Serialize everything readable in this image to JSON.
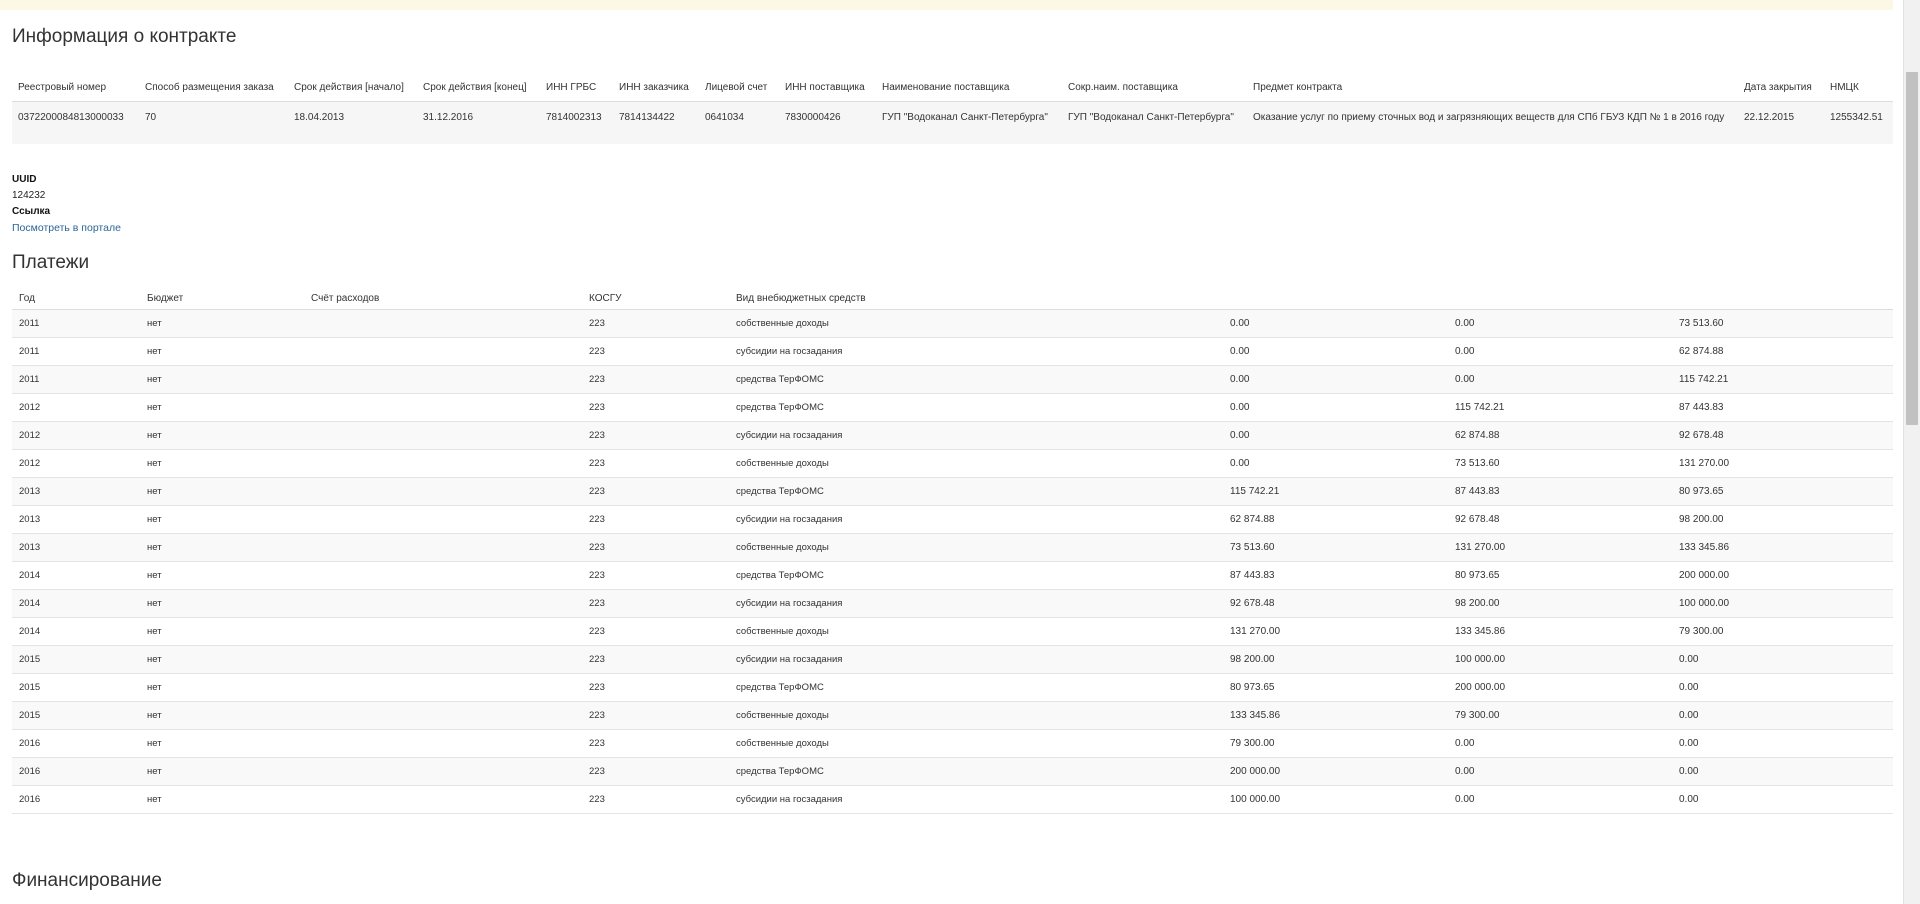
{
  "contract": {
    "title": "Информация о контракте",
    "headers": [
      "Реестровый номер",
      "Способ размещения заказа",
      "Срок действия [начало]",
      "Срок действия [конец]",
      "ИНН ГРБС",
      "ИНН заказчика",
      "Лицевой счет",
      "ИНН поставщика",
      "Наименование поставщика",
      "Сокр.наим. поставщика",
      "Предмет контракта",
      "Дата закрытия",
      "НМЦК"
    ],
    "row": {
      "reg_number": "0372200084813000033",
      "method": "70",
      "start": "18.04.2013",
      "end": "31.12.2016",
      "inn_grbs": "7814002313",
      "inn_customer": "7814134422",
      "account": "0641034",
      "inn_supplier": "7830000426",
      "supplier_name": "ГУП \"Водоканал Санкт-Петербурга\"",
      "supplier_short": "ГУП \"Водоканал Санкт-Петербурга\"",
      "subject": "Оказание услуг по приему сточных вод и загрязняющих веществ для СПб ГБУЗ КДП № 1 в 2016 году",
      "close_date": "22.12.2015",
      "nmck": "1255342.51"
    }
  },
  "info": {
    "uuid_label": "UUID",
    "uuid_value": "124232",
    "link_label": "Ссылка",
    "link_text": "Посмотреть в портале"
  },
  "payments": {
    "title": "Платежи",
    "headers": [
      "Год",
      "Бюджет",
      "Счёт расходов",
      "КОСГУ",
      "Вид внебюджетных средств",
      "",
      "",
      ""
    ],
    "rows": [
      {
        "year": "2011",
        "budget": "нет",
        "account": "",
        "kosgu": "223",
        "kind": "собственные доходы",
        "v1": "0.00",
        "v2": "0.00",
        "v3": "73 513.60"
      },
      {
        "year": "2011",
        "budget": "нет",
        "account": "",
        "kosgu": "223",
        "kind": "субсидии на госзадания",
        "v1": "0.00",
        "v2": "0.00",
        "v3": "62 874.88"
      },
      {
        "year": "2011",
        "budget": "нет",
        "account": "",
        "kosgu": "223",
        "kind": "средства ТерФОМС",
        "v1": "0.00",
        "v2": "0.00",
        "v3": "115 742.21"
      },
      {
        "year": "2012",
        "budget": "нет",
        "account": "",
        "kosgu": "223",
        "kind": "средства ТерФОМС",
        "v1": "0.00",
        "v2": "115 742.21",
        "v3": "87 443.83"
      },
      {
        "year": "2012",
        "budget": "нет",
        "account": "",
        "kosgu": "223",
        "kind": "субсидии на госзадания",
        "v1": "0.00",
        "v2": "62 874.88",
        "v3": "92 678.48"
      },
      {
        "year": "2012",
        "budget": "нет",
        "account": "",
        "kosgu": "223",
        "kind": "собственные доходы",
        "v1": "0.00",
        "v2": "73 513.60",
        "v3": "131 270.00"
      },
      {
        "year": "2013",
        "budget": "нет",
        "account": "",
        "kosgu": "223",
        "kind": "средства ТерФОМС",
        "v1": "115 742.21",
        "v2": "87 443.83",
        "v3": "80 973.65"
      },
      {
        "year": "2013",
        "budget": "нет",
        "account": "",
        "kosgu": "223",
        "kind": "субсидии на госзадания",
        "v1": "62 874.88",
        "v2": "92 678.48",
        "v3": "98 200.00"
      },
      {
        "year": "2013",
        "budget": "нет",
        "account": "",
        "kosgu": "223",
        "kind": "собственные доходы",
        "v1": "73 513.60",
        "v2": "131 270.00",
        "v3": "133 345.86"
      },
      {
        "year": "2014",
        "budget": "нет",
        "account": "",
        "kosgu": "223",
        "kind": "средства ТерФОМС",
        "v1": "87 443.83",
        "v2": "80 973.65",
        "v3": "200 000.00"
      },
      {
        "year": "2014",
        "budget": "нет",
        "account": "",
        "kosgu": "223",
        "kind": "субсидии на госзадания",
        "v1": "92 678.48",
        "v2": "98 200.00",
        "v3": "100 000.00"
      },
      {
        "year": "2014",
        "budget": "нет",
        "account": "",
        "kosgu": "223",
        "kind": "собственные доходы",
        "v1": "131 270.00",
        "v2": "133 345.86",
        "v3": "79 300.00"
      },
      {
        "year": "2015",
        "budget": "нет",
        "account": "",
        "kosgu": "223",
        "kind": "субсидии на госзадания",
        "v1": "98 200.00",
        "v2": "100 000.00",
        "v3": "0.00"
      },
      {
        "year": "2015",
        "budget": "нет",
        "account": "",
        "kosgu": "223",
        "kind": "средства ТерФОМС",
        "v1": "80 973.65",
        "v2": "200 000.00",
        "v3": "0.00"
      },
      {
        "year": "2015",
        "budget": "нет",
        "account": "",
        "kosgu": "223",
        "kind": "собственные доходы",
        "v1": "133 345.86",
        "v2": "79 300.00",
        "v3": "0.00"
      },
      {
        "year": "2016",
        "budget": "нет",
        "account": "",
        "kosgu": "223",
        "kind": "собственные доходы",
        "v1": "79 300.00",
        "v2": "0.00",
        "v3": "0.00"
      },
      {
        "year": "2016",
        "budget": "нет",
        "account": "",
        "kosgu": "223",
        "kind": "средства ТерФОМС",
        "v1": "200 000.00",
        "v2": "0.00",
        "v3": "0.00"
      },
      {
        "year": "2016",
        "budget": "нет",
        "account": "",
        "kosgu": "223",
        "kind": "субсидии на госзадания",
        "v1": "100 000.00",
        "v2": "0.00",
        "v3": "0.00"
      }
    ]
  },
  "financing": {
    "title": "Финансирование"
  }
}
